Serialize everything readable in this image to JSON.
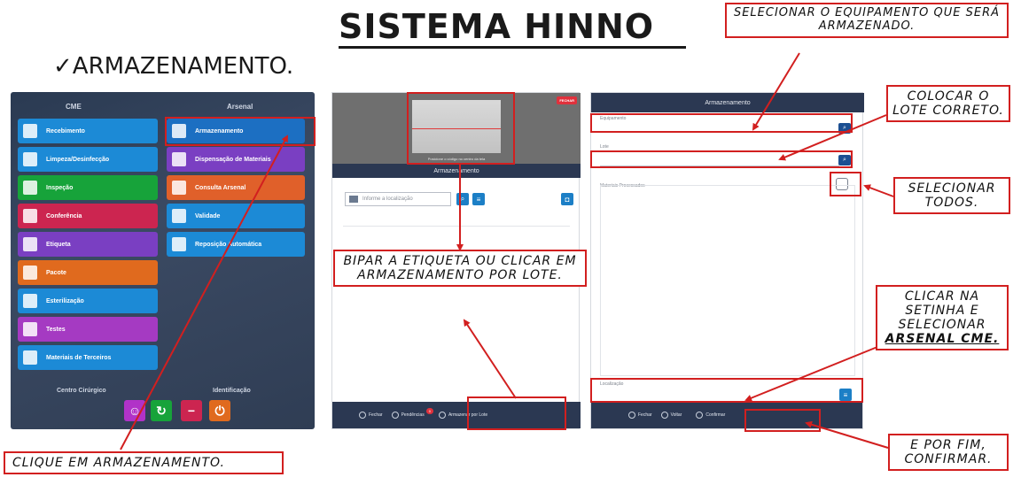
{
  "title": "SISTEMA HINNO",
  "subtitle": "✓ARMAZENAMENTO.",
  "panel1": {
    "cme_header": "CME",
    "arsenal_header": "Arsenal",
    "cme_items": [
      {
        "label": "Recebimento",
        "color": "#1c8ad6"
      },
      {
        "label": "Limpeza/Desinfecção",
        "color": "#1c8ad6"
      },
      {
        "label": "Inspeção",
        "color": "#17a33a"
      },
      {
        "label": "Conferência",
        "color": "#cc2550"
      },
      {
        "label": "Etiqueta",
        "color": "#7a3fc2"
      },
      {
        "label": "Pacote",
        "color": "#e06a1e"
      },
      {
        "label": "Esterilização",
        "color": "#1c8ad6"
      },
      {
        "label": "Testes",
        "color": "#a53ac2"
      },
      {
        "label": "Materiais de Terceiros",
        "color": "#1c8ad6"
      }
    ],
    "arsenal_items": [
      {
        "label": "Armazenamento",
        "color": "#1c6fc2"
      },
      {
        "label": "Dispensação de Materiais",
        "color": "#7a3fc2"
      },
      {
        "label": "Consulta Arsenal",
        "color": "#e0602a"
      },
      {
        "label": "Validade",
        "color": "#1c8ad6"
      },
      {
        "label": "Reposição Automática",
        "color": "#1c8ad6"
      }
    ],
    "centro_cirurgico": "Centro Cirúrgico",
    "identificacao": "Identificação"
  },
  "panel2": {
    "fechar_tag": "FECHAR",
    "camera_hint": "Posicione o código no centro da tela",
    "header": "Armazenamento",
    "location_placeholder": "Informe a localização",
    "footer": {
      "fechar": "Fechar",
      "pendencias": "Pendências",
      "badge": "0",
      "armazenar_lote": "Armazenar por Lote"
    }
  },
  "panel3": {
    "header": "Armazenamento",
    "equipamento_label": "Equipamento",
    "lote_label": "Lote",
    "materiais_label": "Materiais Processados",
    "localizacao_label": "Localização",
    "footer": {
      "fechar": "Fechar",
      "voltar": "Voltar",
      "confirmar": "Confirmar"
    }
  },
  "annotations": {
    "select_equipment": "SELECIONAR O EQUIPAMENTO QUE SERÁ ARMAZENADO.",
    "lote": "COLOCAR O LOTE CORRETO.",
    "select_all": "SELECIONAR TODOS.",
    "bipar": "BIPAR A ETIQUETA OU CLICAR EM ARMAZENAMENTO POR LOTE.",
    "arsenal_pre": "CLICAR NA SETINHA E SELECIONAR",
    "arsenal_cme": "ARSENAL CME.",
    "confirm": "E POR FIM, CONFIRMAR.",
    "click_storage": "CLIQUE EM ARMAZENAMENTO."
  },
  "colors": {
    "accent_red": "#d21f1f",
    "navy": "#2b3852"
  }
}
